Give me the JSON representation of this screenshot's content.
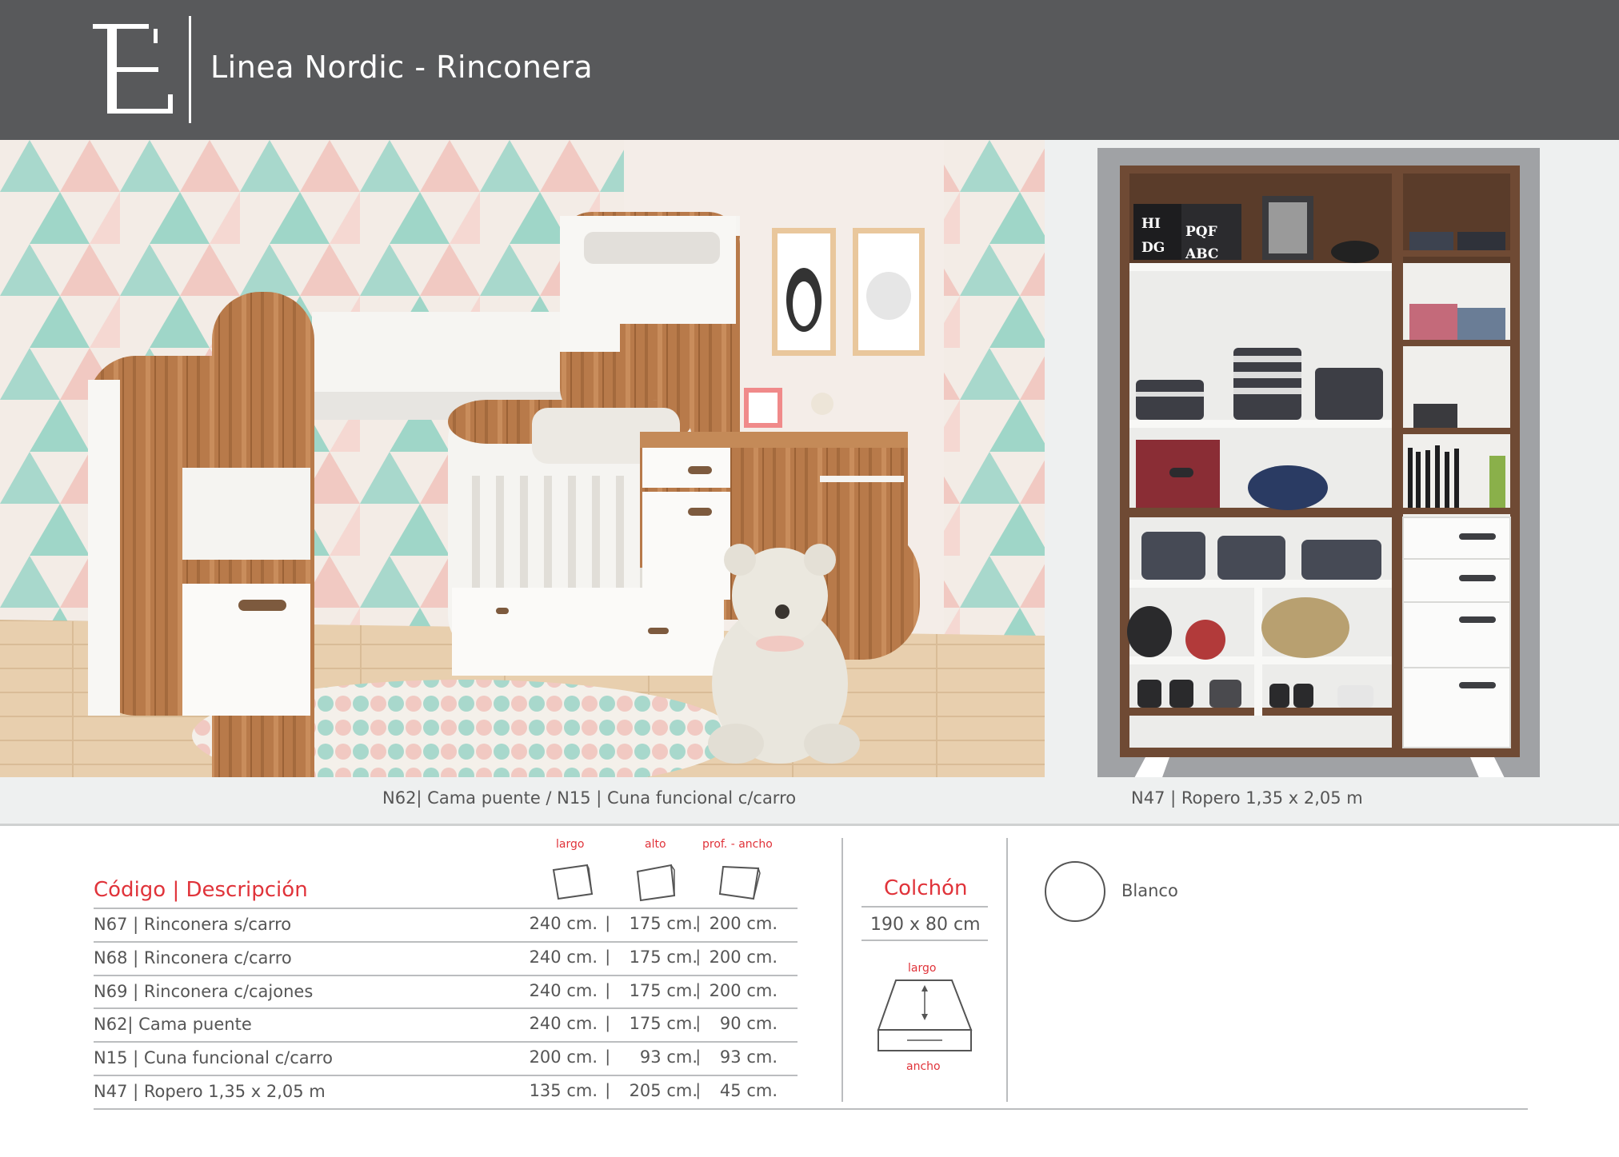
{
  "header": {
    "logo_letter": "E",
    "title": "Linea Nordic - Rinconera"
  },
  "captions": {
    "main_photo": "N62| Cama puente / N15 | Cuna funcional c/carro",
    "wardrobe_photo": "N47 | Ropero 1,35 x 2,05 m"
  },
  "wardrobe_box_labels": [
    "HI",
    "PQF",
    "DG",
    "ABC"
  ],
  "table": {
    "heading": "Código | Descripción",
    "dimension_labels": [
      "largo",
      "alto",
      "prof. - ancho"
    ],
    "rows": [
      {
        "desc": "N67 | Rinconera s/carro",
        "largo": "240 cm.",
        "alto": "175 cm.",
        "ancho": "200 cm."
      },
      {
        "desc": "N68 | Rinconera c/carro",
        "largo": "240 cm.",
        "alto": "175 cm.",
        "ancho": "200 cm."
      },
      {
        "desc": "N69 | Rinconera c/cajones",
        "largo": "240 cm.",
        "alto": "175 cm.",
        "ancho": "200 cm."
      },
      {
        "desc": "N62| Cama puente",
        "largo": "240 cm.",
        "alto": "175 cm.",
        "ancho": "90 cm."
      },
      {
        "desc": "N15 | Cuna funcional c/carro",
        "largo": "200 cm.",
        "alto": "93 cm.",
        "ancho": "93 cm."
      },
      {
        "desc": "N47 | Ropero 1,35 x 2,05 m",
        "largo": "135 cm.",
        "alto": "205 cm.",
        "ancho": "45 cm."
      }
    ],
    "separator": "|"
  },
  "colchon": {
    "title": "Colchón",
    "size": "190 x 80 cm",
    "label_top": "largo",
    "label_bottom": "ancho"
  },
  "color_option": {
    "name": "Blanco",
    "swatch": "#ffffff"
  },
  "colors": {
    "header_bg": "#58595b",
    "accent": "#e0333a",
    "text": "#555555"
  }
}
